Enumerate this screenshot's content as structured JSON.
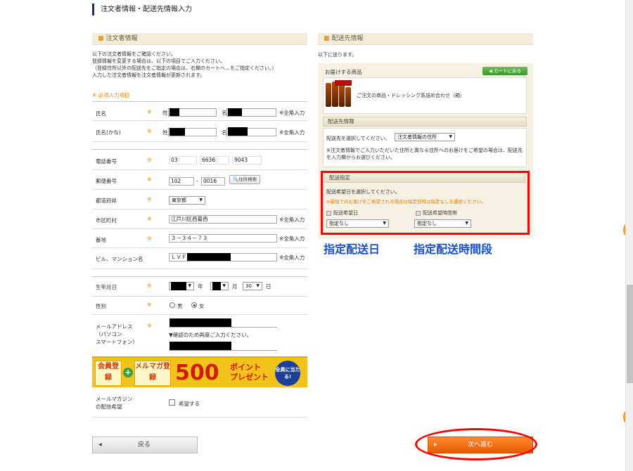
{
  "page": {
    "title": "注文者情報・配送先情報入力"
  },
  "orderer": {
    "heading": "注文者情報",
    "intro": [
      "以下の注文者情報をご確認ください。",
      "登録情報を変更する場合は、以下の項目でご入力ください。",
      "（登録住所以外の配送先をご指定の場合は、右欄のカートへ…をご指定ください。）",
      "入力した注文者情報を注文者情報が更新されます。"
    ],
    "required_note": "※ 必須入力項目",
    "required_mark": "※",
    "name": {
      "label": "氏名",
      "sei": "姓",
      "mei": "名",
      "hint": "※全角入力"
    },
    "kana": {
      "label": "氏名(かな)",
      "sei": "姓",
      "mei": "名",
      "hint": "※全角入力"
    },
    "phone": {
      "label": "電話番号",
      "p1": "03",
      "p2": "6636",
      "p3": "9043"
    },
    "postal": {
      "label": "郵便番号",
      "p1": "102",
      "sep": "-",
      "p2": "0016",
      "search_btn": "住所検索"
    },
    "pref": {
      "label": "都道府県",
      "value": "東京都"
    },
    "city": {
      "label": "市区町村",
      "value": "江戸川区西葛西",
      "hint": "※全角入力"
    },
    "street": {
      "label": "番地",
      "value": "３－３４－７３",
      "hint": "※全角入力"
    },
    "building": {
      "label": "ビル、マンション名",
      "value": "ＬＶＦ",
      "hint": "※全角入力"
    },
    "birthday": {
      "label": "生年月日",
      "y_suffix": "年",
      "m_suffix": "月",
      "d_value": "30",
      "d_suffix": "日"
    },
    "gender": {
      "label": "性別",
      "male": "男",
      "female": "女"
    },
    "email": {
      "label": [
        "メールアドレス",
        "（パソコン",
        "スマートフォン）"
      ],
      "confirm_note": "▼確認のため再度ご入力ください。"
    },
    "newsletter": {
      "label": [
        "メールマガジン",
        "の配信希望"
      ],
      "option": "希望する"
    }
  },
  "banner": {
    "b1": "会員登録",
    "plus": "+",
    "b2": "メルマガ登録",
    "points": "500",
    "points_unit": "ポイント",
    "present": "プレゼント",
    "circle": "全員に当たる!"
  },
  "shipping": {
    "heading": "配送先情報",
    "note": "以下に送ります。",
    "items_heading": "お届けする商品",
    "cart_btn": "カートに戻る",
    "item_desc": "ご注文の商品・ドレッシング系詰め合わせ（箱）",
    "dest_heading": "配送先情報",
    "dest_label": "配送先を選択してください。",
    "dest_value": "注文者情報の住所",
    "dest_note": "※注文者情報でご入力いただいた住所と異なる住所へのお届けをご希望の場合は、配送先を入力欄からお選びください。",
    "delivery_heading": "配送指定",
    "delivery_instr": "配送希望日を選択してください。",
    "delivery_warn": "※最短でのお届けをご希望される場合は指定日時は指定なしを選択ください。",
    "date_label": "配送希望日",
    "date_value": "指定なし",
    "time_label": "配送希望時間帯",
    "time_value": "指定なし"
  },
  "annotations": {
    "date": "指定配送日",
    "time": "指定配送時間段"
  },
  "buttons": {
    "back": "戻る",
    "next": "次へ進む",
    "back_arrow": "◀",
    "next_arrow": "▶"
  },
  "colors": {
    "accent_orange": "#e85a00",
    "annotation_red": "#ff0000",
    "annotation_blue": "#1650d0",
    "section_bg": "#f3ecd9"
  }
}
